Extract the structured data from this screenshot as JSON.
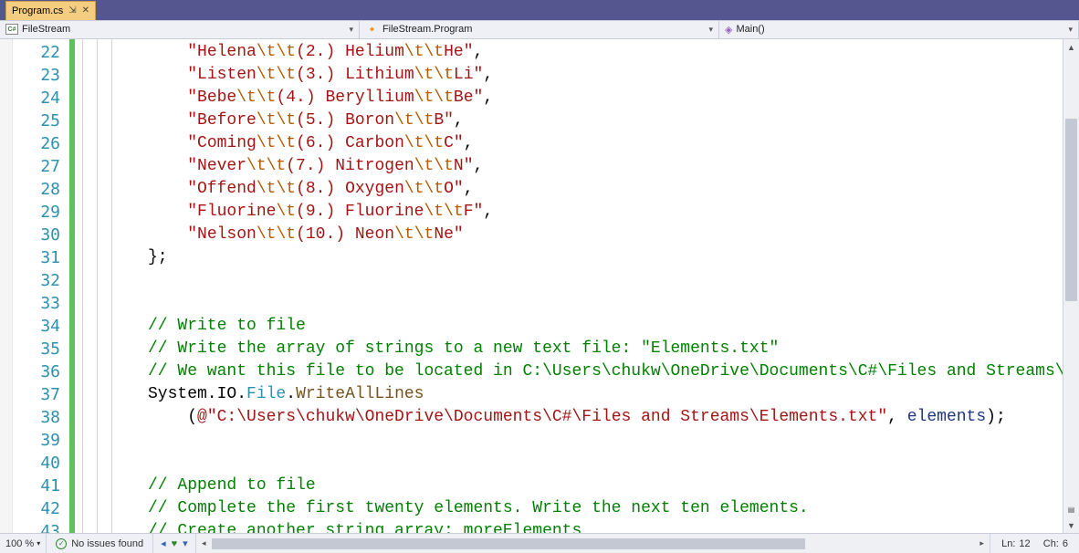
{
  "tab": {
    "title": "Program.cs"
  },
  "context": {
    "scope": "FileStream",
    "class": "FileStream.Program",
    "method": "Main()"
  },
  "lines": {
    "start": 22,
    "end": 43
  },
  "code": {
    "l22": {
      "pre": "\"Helena",
      "esc1": "\\t\\t",
      "mid": "(2.) Helium",
      "esc2": "\\t\\t",
      "suf": "He\"",
      "tail": ","
    },
    "l23": {
      "pre": "\"Listen",
      "esc1": "\\t\\t",
      "mid": "(3.) Lithium",
      "esc2": "\\t\\t",
      "suf": "Li\"",
      "tail": ","
    },
    "l24": {
      "pre": "\"Bebe",
      "esc1": "\\t\\t",
      "mid": "(4.) Beryllium",
      "esc2": "\\t\\t",
      "suf": "Be\"",
      "tail": ","
    },
    "l25": {
      "pre": "\"Before",
      "esc1": "\\t\\t",
      "mid": "(5.) Boron",
      "esc2": "\\t\\t",
      "suf": "B\"",
      "tail": ","
    },
    "l26": {
      "pre": "\"Coming",
      "esc1": "\\t\\t",
      "mid": "(6.) Carbon",
      "esc2": "\\t\\t",
      "suf": "C\"",
      "tail": ","
    },
    "l27": {
      "pre": "\"Never",
      "esc1": "\\t\\t",
      "mid": "(7.) Nitrogen",
      "esc2": "\\t\\t",
      "suf": "N\"",
      "tail": ","
    },
    "l28": {
      "pre": "\"Offend",
      "esc1": "\\t\\t",
      "mid": "(8.) Oxygen",
      "esc2": "\\t\\t",
      "suf": "O\"",
      "tail": ","
    },
    "l29": {
      "pre": "\"Fluorine",
      "esc1": "\\t",
      "mid": "(9.) Fluorine",
      "esc2": "\\t\\t",
      "suf": "F\"",
      "tail": ","
    },
    "l30": {
      "pre": "\"Nelson",
      "esc1": "\\t\\t",
      "mid": "(10.) Neon",
      "esc2": "\\t\\t",
      "suf": "Ne\"",
      "tail": ""
    },
    "l31": "};",
    "l34": "// Write to file",
    "l35": "// Write the array of strings to a new text file: \"Elements.txt\"",
    "l36": "// We want this file to be located in C:\\Users\\chukw\\OneDrive\\Documents\\C#\\Files and Streams\\",
    "l37": {
      "ns": "System.IO.",
      "type": "File",
      "dot": ".",
      "method": "WriteAllLines"
    },
    "l38": {
      "open": "    (",
      "str": "@\"C:\\Users\\chukw\\OneDrive\\Documents\\C#\\Files and Streams\\Elements.txt\"",
      "comma": ", ",
      "param": "elements",
      "close": ");"
    },
    "l41": "// Append to file",
    "l42": "// Complete the first twenty elements. Write the next ten elements.",
    "l43": "// Create another string array: moreElements"
  },
  "status": {
    "zoom": "100 %",
    "issues": "No issues found",
    "line_label": "Ln:",
    "line": "12",
    "ch_label": "Ch:",
    "ch": "6"
  }
}
